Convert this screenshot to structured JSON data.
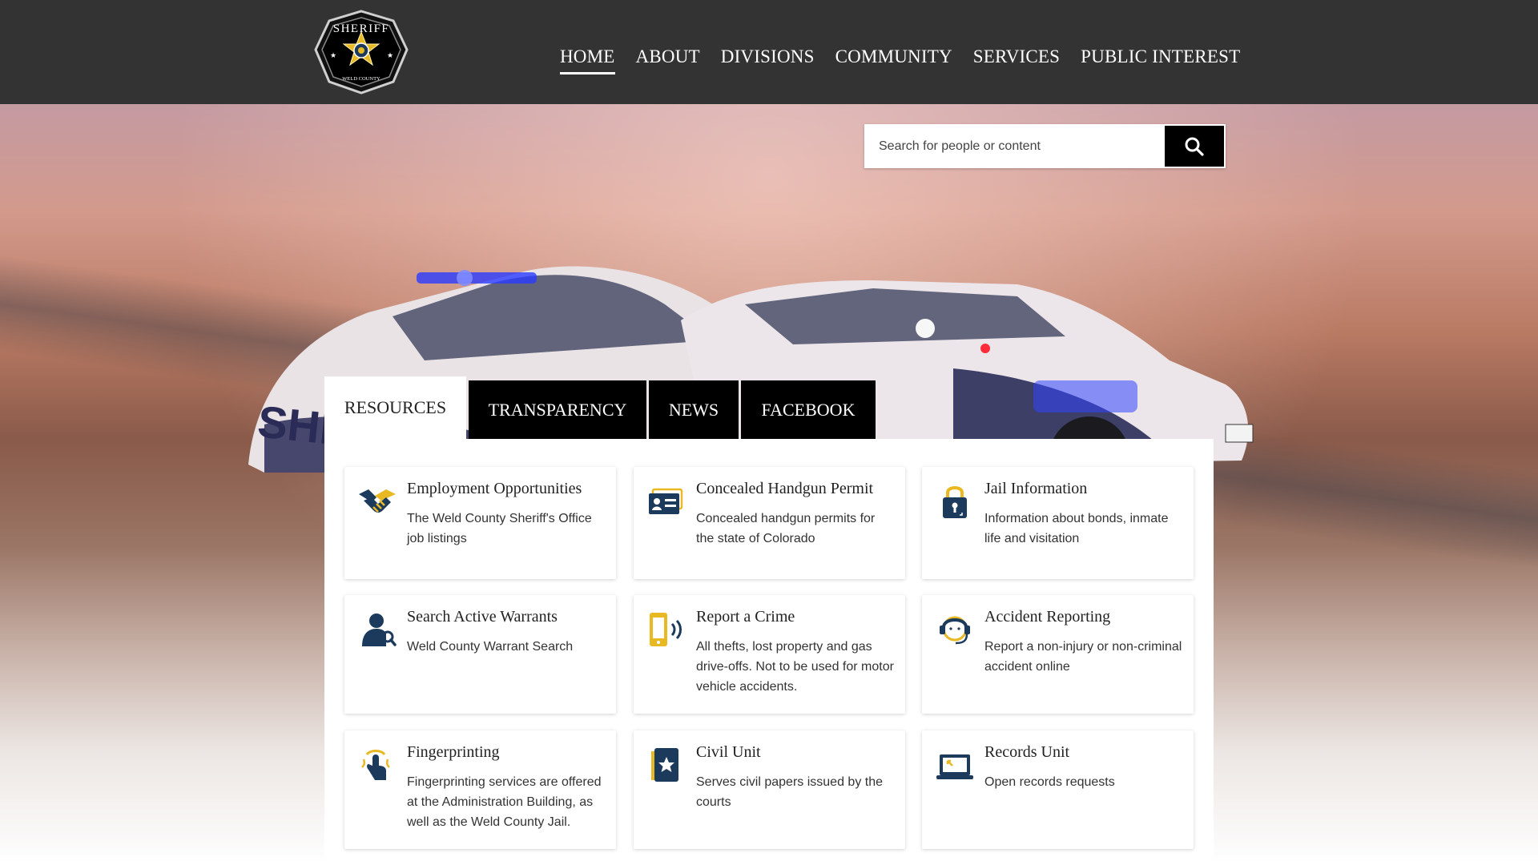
{
  "header": {
    "logo": {
      "top_text": "SHERIFF",
      "bottom_text": "WELD COUNTY"
    },
    "nav": [
      {
        "label": "HOME",
        "active": true
      },
      {
        "label": "ABOUT",
        "active": false
      },
      {
        "label": "DIVISIONS",
        "active": false
      },
      {
        "label": "COMMUNITY",
        "active": false
      },
      {
        "label": "SERVICES",
        "active": false
      },
      {
        "label": "PUBLIC INTEREST",
        "active": false
      }
    ]
  },
  "search": {
    "placeholder": "Search for people or content",
    "value": "",
    "icon": "search-icon"
  },
  "tabs": [
    {
      "label": "RESOURCES",
      "active": true
    },
    {
      "label": "TRANSPARENCY",
      "active": false
    },
    {
      "label": "NEWS",
      "active": false
    },
    {
      "label": "FACEBOOK",
      "active": false
    }
  ],
  "cards": [
    {
      "title": "Employment Opportunities",
      "description": "The Weld County Sheriff's Office job listings",
      "icon": "handshake-icon"
    },
    {
      "title": "Concealed Handgun Permit",
      "description": "Concealed handgun permits for the state of Colorado",
      "icon": "id-card-icon"
    },
    {
      "title": "Jail Information",
      "description": "Information about bonds, inmate life and visitation",
      "icon": "lock-icon"
    },
    {
      "title": "Search Active Warrants",
      "description": "Weld County Warrant Search",
      "icon": "person-search-icon"
    },
    {
      "title": "Report a Crime",
      "description": "All thefts, lost property and gas drive-offs. Not to be used for motor vehicle accidents.",
      "icon": "phone-icon"
    },
    {
      "title": "Accident Reporting",
      "description": "Report a non-injury or non-criminal accident online",
      "icon": "headset-agent-icon"
    },
    {
      "title": "Fingerprinting",
      "description": "Fingerprinting services are offered at the Administration Building, as well as the Weld County Jail.",
      "icon": "fingerprint-touch-icon"
    },
    {
      "title": "Civil Unit",
      "description": "Serves civil papers issued by the courts",
      "icon": "civil-papers-icon"
    },
    {
      "title": "Records Unit",
      "description": "Open records requests",
      "icon": "laptop-icon"
    }
  ],
  "colors": {
    "header_bg": "#333333",
    "icon_navy": "#1b3a5c",
    "icon_gold": "#e8b923",
    "tab_bg": "#000000"
  }
}
